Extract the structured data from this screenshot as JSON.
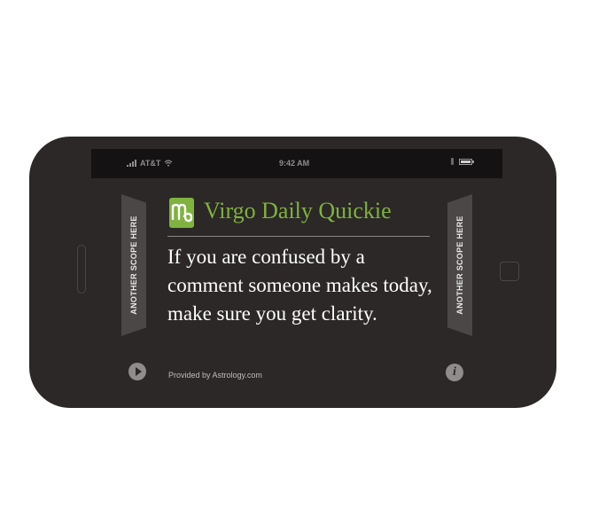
{
  "status_bar": {
    "carrier": "AT&T",
    "time": "9:42 AM",
    "icons": [
      "signal-icon",
      "wifi-icon",
      "lock-icon",
      "battery-icon"
    ]
  },
  "side_tabs": {
    "left_label": "ANOTHER SCOPE HERE",
    "right_label": "ANOTHER SCOPE HERE"
  },
  "widget": {
    "sign_icon": "virgo-icon",
    "title": "Virgo Daily Quickie",
    "horoscope": "If you are confused by a comment someone makes today, make sure you get clarity.",
    "provider": "Provided by Astrology.com",
    "play_icon": "play-icon",
    "info_icon": "info-icon",
    "info_glyph": "i"
  },
  "colors": {
    "phone_body": "#2b2827",
    "status_bar": "#141212",
    "title_green": "#7fb23f",
    "side_tab": "#4a4746",
    "text": "#ffffff"
  }
}
